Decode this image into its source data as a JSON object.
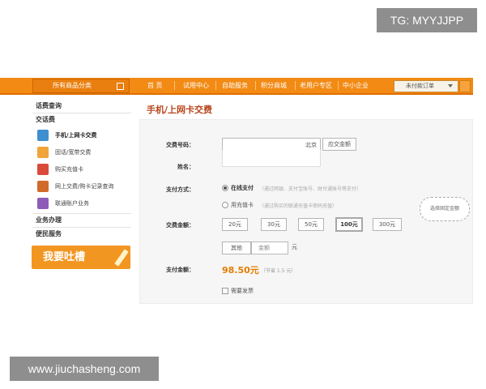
{
  "watermarks": {
    "top_right": "TG: MYYJJPP",
    "bottom_left": "www.jiuchasheng.com"
  },
  "header": {
    "all_goods": "所有商品分类",
    "nav": [
      "首 页",
      "试用中心",
      "自助服务",
      "积分商城",
      "老用户专区",
      "中小企业"
    ],
    "order_dropdown": "未付款订单"
  },
  "sidebar": {
    "sections": [
      {
        "label": "话费查询"
      },
      {
        "label": "交话费"
      }
    ],
    "sub_items": [
      {
        "label": "手机/上网卡交费",
        "icon": "phone-icon",
        "color": "#3f8fcf"
      },
      {
        "label": "固话/宽带交费",
        "icon": "landline-icon",
        "color": "#f0a43a"
      },
      {
        "label": "购买充值卡",
        "icon": "card-icon",
        "color": "#d84b3b"
      },
      {
        "label": "网上交费/购卡记录查询",
        "icon": "record-icon",
        "color": "#d06a2a"
      },
      {
        "label": "联通账户业务",
        "icon": "account-icon",
        "color": "#8e5bb8"
      }
    ],
    "bottom_sections": [
      {
        "label": "业务办理"
      },
      {
        "label": "便民服务"
      }
    ],
    "complain_banner": "我要吐槽"
  },
  "main": {
    "title": "手机/上网卡交费",
    "form": {
      "phone_label": "交费号码：",
      "phone_region": "北京",
      "query_button": "应交金额",
      "name_label": "姓名：",
      "pay_method_label": "支付方式：",
      "pay_online": "在线支付",
      "pay_online_note": "（通过网银、支付宝账号、财付通账号等支付）",
      "pay_card": "用充值卡",
      "pay_card_note": "（通过购买的联通充值卡密码充值）",
      "amount_label": "交费金额：",
      "amounts": [
        "20元",
        "30元",
        "50元",
        "100元",
        "300元"
      ],
      "selected_amount": "100元",
      "other_label": "其他",
      "other_placeholder": "金额",
      "other_unit": "元",
      "hint": "选择固定金额",
      "total_label": "支付金额：",
      "total_value": "98.50元",
      "discount_note": "（节省 1.5 元）",
      "invoice_label": "需要发票"
    }
  }
}
